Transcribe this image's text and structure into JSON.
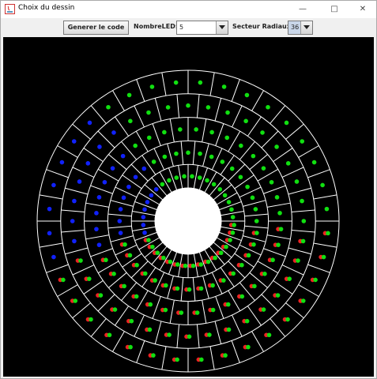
{
  "window": {
    "title": "Choix du dessin"
  },
  "toolbar": {
    "generate_label": "Generer le code",
    "led_label": "NombreLED:",
    "led_value": "5",
    "sector_label": "Secteur Radiaux:",
    "sector_value": "36"
  },
  "wheel": {
    "rings": 5,
    "sectors": 36,
    "colors": {
      "background": "#000000",
      "grid": "#ffffff",
      "green": "#11e011",
      "red": "#ee2222",
      "blue": "#1122ff"
    },
    "pattern_description_in_sectors": {
      "green_sectors": [
        23,
        24,
        25,
        26,
        27,
        28,
        29,
        30,
        31,
        32,
        33,
        34,
        35
      ],
      "red_green_sectors": [
        0,
        1,
        2,
        3,
        4,
        5,
        6,
        7,
        8,
        9,
        10,
        11,
        12,
        13,
        14,
        15
      ],
      "blue_sectors": [
        16,
        17,
        18,
        19,
        20,
        21,
        22
      ]
    }
  }
}
